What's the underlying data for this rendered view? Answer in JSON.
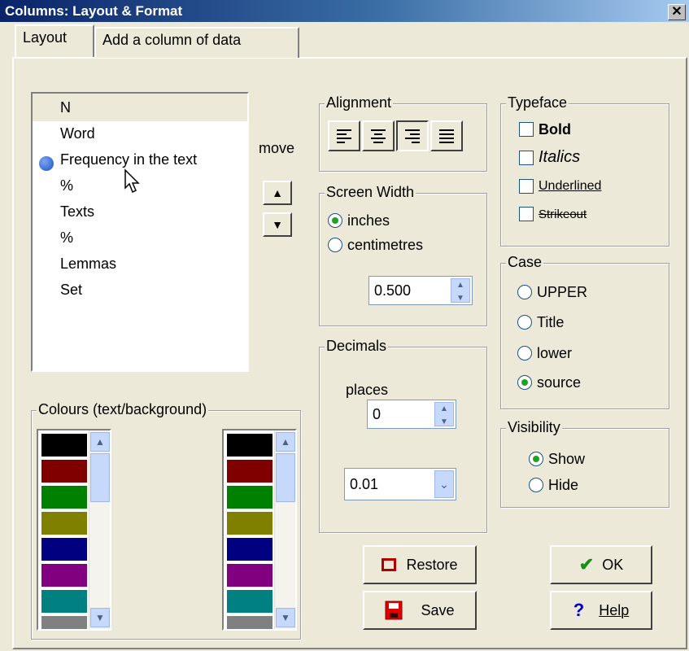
{
  "window": {
    "title": "Columns: Layout & Format",
    "close_glyph": "✕"
  },
  "tabs": [
    "Layout",
    "Add a column of data"
  ],
  "columns": {
    "items": [
      "N",
      "Word",
      "Frequency in the text",
      "%",
      "Texts",
      "%",
      "Lemmas",
      "Set"
    ],
    "selected_index": 2
  },
  "move_label": "move",
  "alignment": {
    "title": "Alignment",
    "icons": [
      "align-left-icon",
      "align-center-icon",
      "align-right-icon",
      "align-justify-icon"
    ]
  },
  "screen_width": {
    "title": "Screen Width",
    "options": [
      "inches",
      "centimetres"
    ],
    "selected": "inches",
    "value": "0.500"
  },
  "decimals": {
    "title": "Decimals",
    "places_label": "places",
    "places_value": "0",
    "rounding_value": "0.01"
  },
  "typeface": {
    "title": "Typeface",
    "options": [
      "Bold",
      "Italics",
      "Underlined",
      "Strikeout"
    ]
  },
  "case": {
    "title": "Case",
    "options": [
      "UPPER",
      "Title",
      "lower",
      "source"
    ],
    "selected": "source"
  },
  "visibility": {
    "title": "Visibility",
    "options": [
      "Show",
      "Hide"
    ],
    "selected": "Show"
  },
  "colours": {
    "title": "Colours (text/background)",
    "swatches": [
      "#000000",
      "#800000",
      "#008000",
      "#808000",
      "#000080",
      "#800080",
      "#008080",
      "#808080"
    ]
  },
  "buttons": {
    "restore": "Restore",
    "save": "Save",
    "ok": "OK",
    "help": "Help"
  }
}
